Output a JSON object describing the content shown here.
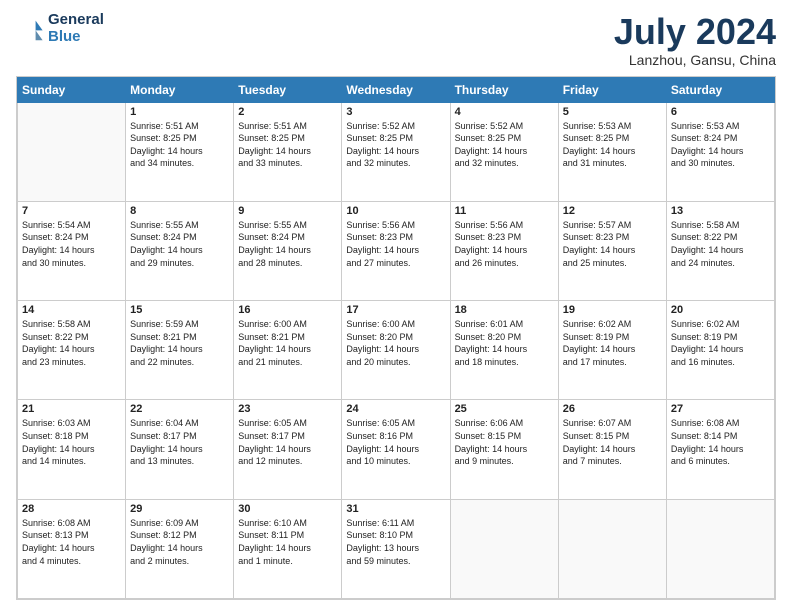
{
  "logo": {
    "line1": "General",
    "line2": "Blue"
  },
  "title": "July 2024",
  "subtitle": "Lanzhou, Gansu, China",
  "weekdays": [
    "Sunday",
    "Monday",
    "Tuesday",
    "Wednesday",
    "Thursday",
    "Friday",
    "Saturday"
  ],
  "weeks": [
    [
      {
        "day": "",
        "info": ""
      },
      {
        "day": "1",
        "info": "Sunrise: 5:51 AM\nSunset: 8:25 PM\nDaylight: 14 hours\nand 34 minutes."
      },
      {
        "day": "2",
        "info": "Sunrise: 5:51 AM\nSunset: 8:25 PM\nDaylight: 14 hours\nand 33 minutes."
      },
      {
        "day": "3",
        "info": "Sunrise: 5:52 AM\nSunset: 8:25 PM\nDaylight: 14 hours\nand 32 minutes."
      },
      {
        "day": "4",
        "info": "Sunrise: 5:52 AM\nSunset: 8:25 PM\nDaylight: 14 hours\nand 32 minutes."
      },
      {
        "day": "5",
        "info": "Sunrise: 5:53 AM\nSunset: 8:25 PM\nDaylight: 14 hours\nand 31 minutes."
      },
      {
        "day": "6",
        "info": "Sunrise: 5:53 AM\nSunset: 8:24 PM\nDaylight: 14 hours\nand 30 minutes."
      }
    ],
    [
      {
        "day": "7",
        "info": "Sunrise: 5:54 AM\nSunset: 8:24 PM\nDaylight: 14 hours\nand 30 minutes."
      },
      {
        "day": "8",
        "info": "Sunrise: 5:55 AM\nSunset: 8:24 PM\nDaylight: 14 hours\nand 29 minutes."
      },
      {
        "day": "9",
        "info": "Sunrise: 5:55 AM\nSunset: 8:24 PM\nDaylight: 14 hours\nand 28 minutes."
      },
      {
        "day": "10",
        "info": "Sunrise: 5:56 AM\nSunset: 8:23 PM\nDaylight: 14 hours\nand 27 minutes."
      },
      {
        "day": "11",
        "info": "Sunrise: 5:56 AM\nSunset: 8:23 PM\nDaylight: 14 hours\nand 26 minutes."
      },
      {
        "day": "12",
        "info": "Sunrise: 5:57 AM\nSunset: 8:23 PM\nDaylight: 14 hours\nand 25 minutes."
      },
      {
        "day": "13",
        "info": "Sunrise: 5:58 AM\nSunset: 8:22 PM\nDaylight: 14 hours\nand 24 minutes."
      }
    ],
    [
      {
        "day": "14",
        "info": "Sunrise: 5:58 AM\nSunset: 8:22 PM\nDaylight: 14 hours\nand 23 minutes."
      },
      {
        "day": "15",
        "info": "Sunrise: 5:59 AM\nSunset: 8:21 PM\nDaylight: 14 hours\nand 22 minutes."
      },
      {
        "day": "16",
        "info": "Sunrise: 6:00 AM\nSunset: 8:21 PM\nDaylight: 14 hours\nand 21 minutes."
      },
      {
        "day": "17",
        "info": "Sunrise: 6:00 AM\nSunset: 8:20 PM\nDaylight: 14 hours\nand 20 minutes."
      },
      {
        "day": "18",
        "info": "Sunrise: 6:01 AM\nSunset: 8:20 PM\nDaylight: 14 hours\nand 18 minutes."
      },
      {
        "day": "19",
        "info": "Sunrise: 6:02 AM\nSunset: 8:19 PM\nDaylight: 14 hours\nand 17 minutes."
      },
      {
        "day": "20",
        "info": "Sunrise: 6:02 AM\nSunset: 8:19 PM\nDaylight: 14 hours\nand 16 minutes."
      }
    ],
    [
      {
        "day": "21",
        "info": "Sunrise: 6:03 AM\nSunset: 8:18 PM\nDaylight: 14 hours\nand 14 minutes."
      },
      {
        "day": "22",
        "info": "Sunrise: 6:04 AM\nSunset: 8:17 PM\nDaylight: 14 hours\nand 13 minutes."
      },
      {
        "day": "23",
        "info": "Sunrise: 6:05 AM\nSunset: 8:17 PM\nDaylight: 14 hours\nand 12 minutes."
      },
      {
        "day": "24",
        "info": "Sunrise: 6:05 AM\nSunset: 8:16 PM\nDaylight: 14 hours\nand 10 minutes."
      },
      {
        "day": "25",
        "info": "Sunrise: 6:06 AM\nSunset: 8:15 PM\nDaylight: 14 hours\nand 9 minutes."
      },
      {
        "day": "26",
        "info": "Sunrise: 6:07 AM\nSunset: 8:15 PM\nDaylight: 14 hours\nand 7 minutes."
      },
      {
        "day": "27",
        "info": "Sunrise: 6:08 AM\nSunset: 8:14 PM\nDaylight: 14 hours\nand 6 minutes."
      }
    ],
    [
      {
        "day": "28",
        "info": "Sunrise: 6:08 AM\nSunset: 8:13 PM\nDaylight: 14 hours\nand 4 minutes."
      },
      {
        "day": "29",
        "info": "Sunrise: 6:09 AM\nSunset: 8:12 PM\nDaylight: 14 hours\nand 2 minutes."
      },
      {
        "day": "30",
        "info": "Sunrise: 6:10 AM\nSunset: 8:11 PM\nDaylight: 14 hours\nand 1 minute."
      },
      {
        "day": "31",
        "info": "Sunrise: 6:11 AM\nSunset: 8:10 PM\nDaylight: 13 hours\nand 59 minutes."
      },
      {
        "day": "",
        "info": ""
      },
      {
        "day": "",
        "info": ""
      },
      {
        "day": "",
        "info": ""
      }
    ]
  ]
}
